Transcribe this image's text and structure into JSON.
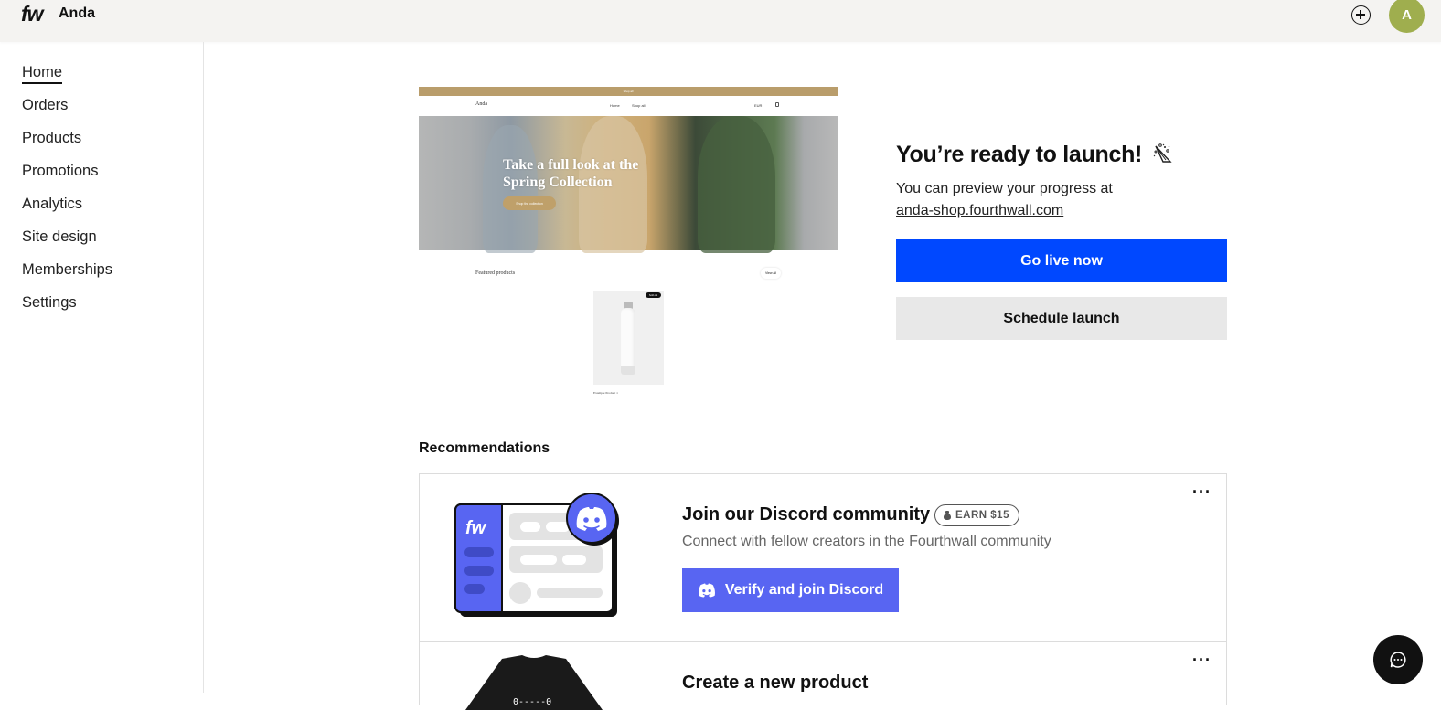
{
  "header": {
    "logo": "fw",
    "shop_name": "Anda",
    "add_icon": "plus-circle-icon",
    "avatar_initial": "A",
    "avatar_color": "#9fae4e"
  },
  "sidebar": {
    "items": [
      {
        "label": "Home",
        "active": true
      },
      {
        "label": "Orders"
      },
      {
        "label": "Products"
      },
      {
        "label": "Promotions"
      },
      {
        "label": "Analytics"
      },
      {
        "label": "Site design"
      },
      {
        "label": "Memberships"
      },
      {
        "label": "Settings"
      }
    ]
  },
  "preview": {
    "announcement": "Shop all",
    "brand": "Anda",
    "nav_links": [
      "Home",
      "Shop all"
    ],
    "currency": "EUR",
    "hero_title_line1": "Take a full look at the",
    "hero_title_line2": "Spring Collection",
    "hero_button": "Shop the collection",
    "featured_heading": "Featured products",
    "view_all": "View all",
    "product_badge": "Sold out",
    "product_name": "Example Product 1"
  },
  "launch": {
    "title": "You’re ready to launch!",
    "title_icon": "party-popper-icon",
    "subtitle": "You can preview your progress at",
    "link": "anda-shop.fourthwall.com",
    "go_live_label": "Go live now",
    "go_live_color": "#0048ff",
    "schedule_label": "Schedule launch"
  },
  "recommendations": {
    "heading": "Recommendations",
    "cards": [
      {
        "title": "Join our Discord community",
        "badge": "EARN $15",
        "description": "Connect with fellow creators in the Fourthwall community",
        "button_label": "Verify and join Discord",
        "button_color": "#5865f2",
        "illustration_logo": "fw"
      },
      {
        "title": "Create a new product"
      }
    ]
  },
  "chat": {
    "icon": "chat-bubble-icon"
  }
}
